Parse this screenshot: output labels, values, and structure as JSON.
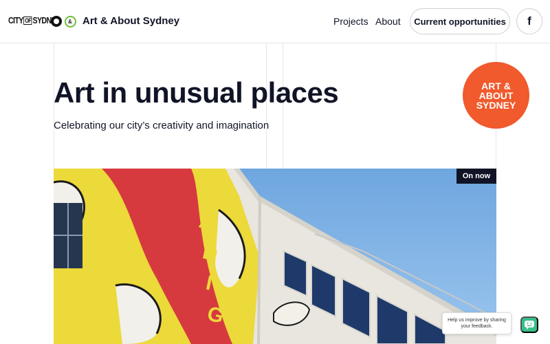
{
  "header": {
    "logo_city": "CITY OF SYDNEY",
    "logo_city_parts": {
      "a": "CITY",
      "b": "OF",
      "c": "SYDNEY"
    },
    "site_title": "Art & About Sydney",
    "nav": [
      {
        "label": "Projects"
      },
      {
        "label": "About"
      }
    ],
    "cta_label": "Current opportunities",
    "facebook_glyph": "f",
    "icons": {
      "emblem": "city-emblem-icon",
      "aa": "art-about-logo-icon",
      "facebook": "facebook-icon"
    }
  },
  "hero": {
    "title": "Art in unusual places",
    "subtitle": "Celebrating our city’s creativity and imagination",
    "badge_text": "ART &\nABOUT\nSYDNEY",
    "badge_color": "#f05a2c",
    "status_label": "On now"
  },
  "feedback": {
    "text": "Help us improve by sharing your feedback.",
    "button_color": "#35c08a"
  },
  "colors": {
    "text": "#101426",
    "brand_orange": "#f05a2c",
    "feedback_green": "#35c08a"
  }
}
